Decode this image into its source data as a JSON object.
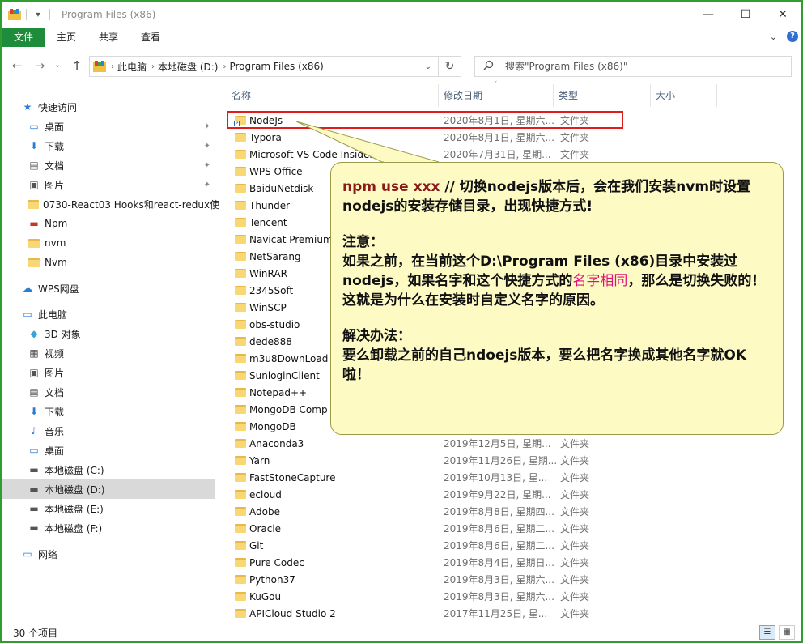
{
  "window": {
    "title": "Program Files (x86)",
    "quick_access_glyph": "▾"
  },
  "caption_buttons": {
    "minimize": "—",
    "maximize": "☐",
    "close": "✕"
  },
  "ribbon": {
    "tabs": [
      "文件",
      "主页",
      "共享",
      "查看"
    ],
    "expand_glyph": "⌄",
    "help_glyph": "?"
  },
  "address": {
    "back": "←",
    "forward": "→",
    "recent": "⌄",
    "up": "↑",
    "segments": [
      "此电脑",
      "本地磁盘 (D:)",
      "Program Files (x86)"
    ],
    "separator": "›",
    "refresh": "↻"
  },
  "search": {
    "placeholder": "搜索\"Program Files (x86)\""
  },
  "nav": {
    "items": [
      {
        "label": "快速访问",
        "icon": "star-icon",
        "glyph": "★",
        "color": "#2f7ad6",
        "pinned": false
      },
      {
        "label": "桌面",
        "icon": "desktop-icon",
        "glyph": "▭",
        "color": "#2a7bd4",
        "pinned": true
      },
      {
        "label": "下载",
        "icon": "download-icon",
        "glyph": "⬇",
        "color": "#2a7bd4",
        "pinned": true
      },
      {
        "label": "文档",
        "icon": "document-icon",
        "glyph": "▤",
        "color": "#555",
        "pinned": true
      },
      {
        "label": "图片",
        "icon": "picture-icon",
        "glyph": "▣",
        "color": "#555",
        "pinned": true
      },
      {
        "label": "0730-React03 Hooks和react-redux使",
        "icon": "folder-icon",
        "glyph": "",
        "color": "#f8d775",
        "pinned": false
      },
      {
        "label": "Npm",
        "icon": "npm-icon",
        "glyph": "▬",
        "color": "#c0392b",
        "pinned": false
      },
      {
        "label": "nvm",
        "icon": "folder-icon",
        "glyph": "",
        "color": "#f8d775",
        "pinned": false
      },
      {
        "label": "Nvm",
        "icon": "folder-icon",
        "glyph": "",
        "color": "#f8d775",
        "pinned": false
      },
      {
        "label": "WPS网盘",
        "icon": "cloud-icon",
        "glyph": "☁",
        "color": "#2a7bd4",
        "pinned": false
      },
      {
        "label": "此电脑",
        "icon": "computer-icon",
        "glyph": "▭",
        "color": "#2a7bd4",
        "pinned": false
      },
      {
        "label": "3D 对象",
        "icon": "3d-objects-icon",
        "glyph": "◆",
        "color": "#38a6d8",
        "pinned": false
      },
      {
        "label": "视频",
        "icon": "video-icon",
        "glyph": "▦",
        "color": "#444",
        "pinned": false
      },
      {
        "label": "图片",
        "icon": "picture-icon",
        "glyph": "▣",
        "color": "#555",
        "pinned": false
      },
      {
        "label": "文档",
        "icon": "document-icon",
        "glyph": "▤",
        "color": "#555",
        "pinned": false
      },
      {
        "label": "下载",
        "icon": "download-icon",
        "glyph": "⬇",
        "color": "#2a7bd4",
        "pinned": false
      },
      {
        "label": "音乐",
        "icon": "music-icon",
        "glyph": "♪",
        "color": "#2a7bd4",
        "pinned": false
      },
      {
        "label": "桌面",
        "icon": "desktop-icon",
        "glyph": "▭",
        "color": "#2a7bd4",
        "pinned": false
      },
      {
        "label": "本地磁盘 (C:)",
        "icon": "drive-icon",
        "glyph": "▬",
        "color": "#555",
        "pinned": false
      },
      {
        "label": "本地磁盘 (D:)",
        "icon": "drive-icon",
        "glyph": "▬",
        "color": "#555",
        "pinned": false,
        "selected": true
      },
      {
        "label": "本地磁盘 (E:)",
        "icon": "drive-icon",
        "glyph": "▬",
        "color": "#555",
        "pinned": false
      },
      {
        "label": "本地磁盘 (F:)",
        "icon": "drive-icon",
        "glyph": "▬",
        "color": "#555",
        "pinned": false
      },
      {
        "label": "网络",
        "icon": "network-icon",
        "glyph": "▭",
        "color": "#2a7bd4",
        "pinned": false
      }
    ],
    "pin_glyph": "📌"
  },
  "columns": {
    "name": "名称",
    "date": "修改日期",
    "type": "类型",
    "size": "大小",
    "sort_glyph": "ˇ"
  },
  "files": [
    {
      "name": "NodeJs",
      "date": "2020年8月1日, 星期六...",
      "type": "文件夹",
      "shortcut": true
    },
    {
      "name": "Typora",
      "date": "2020年8月1日, 星期六...",
      "type": "文件夹"
    },
    {
      "name": "Microsoft VS Code Insiders",
      "date": "2020年7月31日, 星期...",
      "type": "文件夹"
    },
    {
      "name": "WPS Office",
      "date": "",
      "type": ""
    },
    {
      "name": "BaiduNetdisk",
      "date": "",
      "type": ""
    },
    {
      "name": "Thunder",
      "date": "",
      "type": ""
    },
    {
      "name": "Tencent",
      "date": "",
      "type": ""
    },
    {
      "name": "Navicat Premium",
      "date": "",
      "type": ""
    },
    {
      "name": "NetSarang",
      "date": "",
      "type": ""
    },
    {
      "name": "WinRAR",
      "date": "",
      "type": ""
    },
    {
      "name": "2345Soft",
      "date": "",
      "type": ""
    },
    {
      "name": "WinSCP",
      "date": "",
      "type": ""
    },
    {
      "name": "obs-studio",
      "date": "",
      "type": ""
    },
    {
      "name": "dede888",
      "date": "",
      "type": ""
    },
    {
      "name": "m3u8DownLoad",
      "date": "",
      "type": ""
    },
    {
      "name": "SunloginClient",
      "date": "",
      "type": ""
    },
    {
      "name": "Notepad++",
      "date": "",
      "type": ""
    },
    {
      "name": "MongoDB Comp",
      "date": "",
      "type": ""
    },
    {
      "name": "MongoDB",
      "date": "",
      "type": ""
    },
    {
      "name": "Anaconda3",
      "date": "2019年12月5日, 星期...",
      "type": "文件夹"
    },
    {
      "name": "Yarn",
      "date": "2019年11月26日, 星期...",
      "type": "文件夹"
    },
    {
      "name": "FastStoneCapture",
      "date": "2019年10月13日, 星...",
      "type": "文件夹"
    },
    {
      "name": "ecloud",
      "date": "2019年9月22日, 星期...",
      "type": "文件夹"
    },
    {
      "name": "Adobe",
      "date": "2019年8月8日, 星期四...",
      "type": "文件夹"
    },
    {
      "name": "Oracle",
      "date": "2019年8月6日, 星期二...",
      "type": "文件夹"
    },
    {
      "name": "Git",
      "date": "2019年8月6日, 星期二...",
      "type": "文件夹"
    },
    {
      "name": "Pure Codec",
      "date": "2019年8月4日, 星期日...",
      "type": "文件夹"
    },
    {
      "name": "Python37",
      "date": "2019年8月3日, 星期六...",
      "type": "文件夹"
    },
    {
      "name": "KuGou",
      "date": "2019年8月3日, 星期六...",
      "type": "文件夹"
    },
    {
      "name": "APICloud Studio 2",
      "date": "2017年11月25日, 星...",
      "type": "文件夹"
    }
  ],
  "callout": {
    "line1_cmd": "npm use xxx",
    "line1_rest": " // 切换nodejs版本后，会在我们安装nvm时设置nodejs的安装存储目录，出现快捷方式!",
    "note_title": "注意：",
    "note_a": "如果之前，在当前这个D:\\Program Files (x86)目录中安装过nodejs，如果名字和这个快捷方式的",
    "note_highlight": "名字相同",
    "note_b": "，那么是切换失败的！这就是为什么在安装时自定义名字的原因。",
    "solution_title": "解决办法：",
    "solution_text": "要么卸载之前的自己ndoejs版本，要么把名字换成其他名字就OK啦！"
  },
  "status": {
    "count": "30 个项目",
    "details_view_glyph": "☰",
    "tiles_view_glyph": "▦"
  },
  "colors": {
    "window_border": "#2f9e2f",
    "file_tab": "#1e8c3a",
    "highlight_border": "#e21b1b",
    "callout_bg": "#fdfac4",
    "accent_pink": "#e0127a",
    "accent_green": "#1e9a1e",
    "accent_dark_red": "#8b1a1a"
  }
}
